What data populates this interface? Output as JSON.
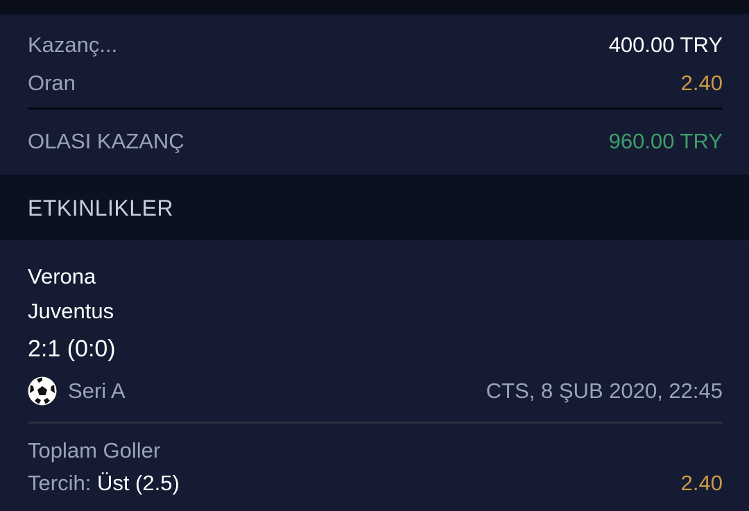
{
  "summary": {
    "stake_label": "Kazanç...",
    "stake_value": "400.00 TRY",
    "odds_label": "Oran",
    "odds_value": "2.40",
    "potential_label": "OLASI KAZANÇ",
    "potential_value": "960.00 TRY"
  },
  "events": {
    "header": "ETKINLIKLER",
    "match": {
      "home": "Verona",
      "away": "Juventus",
      "score": "2:1 (0:0)",
      "league": "Seri A",
      "league_icon": "soccer-ball-icon",
      "datetime": "CTS, 8 ŞUB 2020, 22:45",
      "market": "Toplam Goller",
      "pick_label": "Tercih:",
      "pick_value": "Üst (2.5)",
      "pick_odds": "2.40"
    }
  },
  "colors": {
    "gold": "#c99b45",
    "green": "#3f9d6a"
  }
}
